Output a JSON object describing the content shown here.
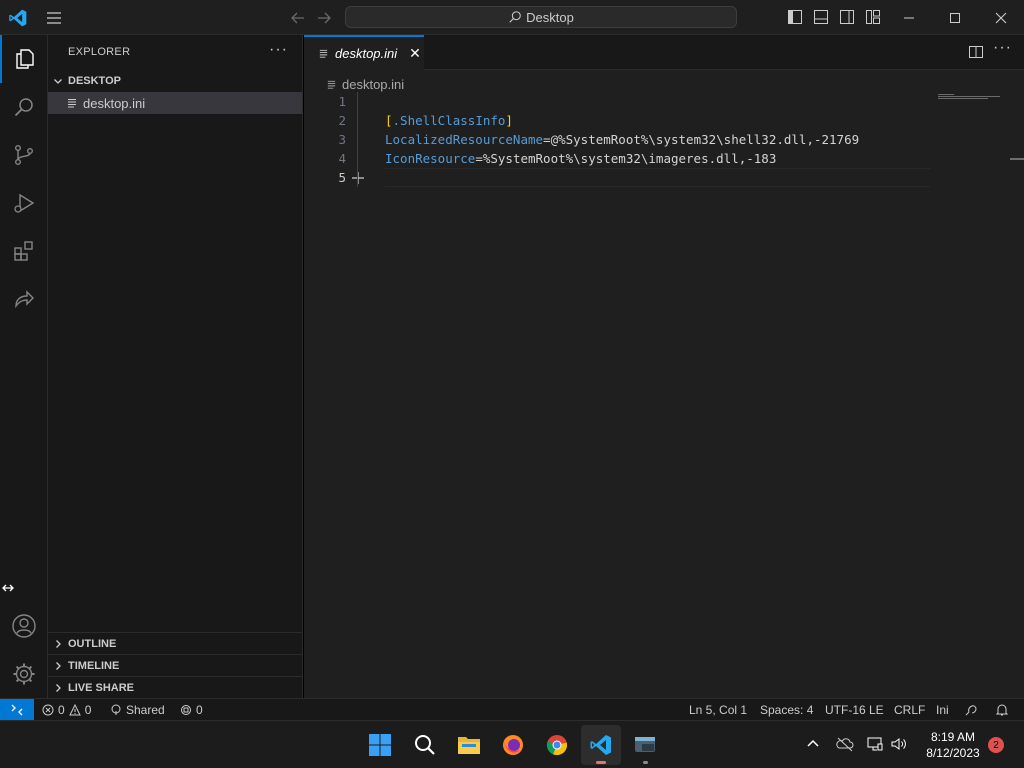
{
  "titlebar": {
    "search_text": "Desktop"
  },
  "sidebar": {
    "header": "EXPLORER",
    "folder": "DESKTOP",
    "files": [
      {
        "name": "desktop.ini"
      }
    ],
    "sections": {
      "outline": "OUTLINE",
      "timeline": "TIMELINE",
      "live_share": "LIVE SHARE"
    }
  },
  "editor": {
    "tab_label": "desktop.ini",
    "breadcrumb": "desktop.ini",
    "lines": [
      {
        "num": "1",
        "text": ""
      },
      {
        "num": "2",
        "text": "[.ShellClassInfo]"
      },
      {
        "num": "3",
        "key": "LocalizedResourceName",
        "eq": "=",
        "val": "@%SystemRoot%\\system32\\shell32.dll,-21769"
      },
      {
        "num": "4",
        "key": "IconResource",
        "eq": "=",
        "val": "%SystemRoot%\\system32\\imageres.dll,-183"
      },
      {
        "num": "5",
        "text": ""
      }
    ],
    "section_open": "[",
    "section_name": ".ShellClassInfo",
    "section_close": "]"
  },
  "statusbar": {
    "errors": "0",
    "warnings": "0",
    "shared": "Shared",
    "ports": "0",
    "position": "Ln 5, Col 1",
    "spaces": "Spaces: 4",
    "encoding": "UTF-16 LE",
    "eol": "CRLF",
    "language": "Ini"
  },
  "taskbar": {
    "time": "8:19 AM",
    "date": "8/12/2023",
    "notification_count": "2"
  },
  "colors": {
    "accent": "#0078d4",
    "keyword": "#569cd6",
    "bracket": "#ffd700"
  }
}
